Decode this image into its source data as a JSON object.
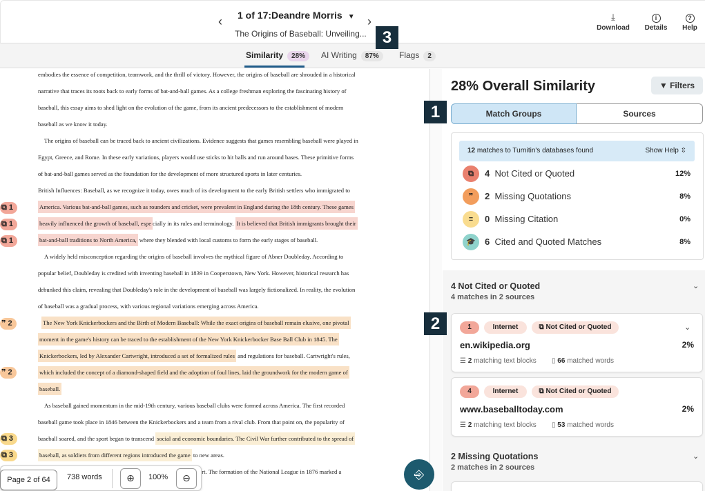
{
  "header": {
    "submission": "1 of 17:Deandre Morris",
    "paper_title": "The Origins of Baseball: Unveiling...",
    "download": "Download",
    "details": "Details",
    "help": "Help"
  },
  "tabs": [
    {
      "label": "Similarity",
      "badge": "28%"
    },
    {
      "label": "AI Writing",
      "badge": "87%"
    },
    {
      "label": "Flags",
      "badge": "2"
    }
  ],
  "callouts": {
    "one": "1",
    "two": "2",
    "three": "3"
  },
  "document": {
    "lines": [
      "embodies the essence of competition, teamwork, and the thrill of victory. However, the origins of baseball are shrouded in a historical",
      "narrative that traces its roots back to early forms of bat-and-ball games. As a college freshman exploring the fascinating history of",
      "baseball, this essay aims to shed light on the evolution of the game, from its ancient predecessors to the establishment of modern",
      "baseball as we know it today.",
      "The origins of baseball can be traced back to ancient civilizations. Evidence suggests that games resembling baseball were played in",
      "Egypt, Greece, and Rome. In these early variations, players would use sticks to hit balls and run around bases. These primitive forms",
      "of bat-and-ball games served as the foundation for the development of more structured sports in later centuries.",
      "British Influences: Baseball, as we recognize it today, owes much of its development to the early British settlers who immigrated to",
      "America. Various bat-and-ball games, such as rounders and cricket, were prevalent in England during the 18th century. These games",
      "heavily influenced the growth of baseball, espe",
      "cially in its rules and terminology. ",
      "It is believed that British immigrants brought their",
      "bat-and-ball traditions to North America,",
      " where they blended with local customs to form the early stages of baseball.",
      "A widely held misconception regarding the origins of baseball involves the mythical figure of Abner Doubleday. According to",
      "popular belief, Doubleday is credited with inventing baseball in 1839 in Cooperstown, New York. However, historical research has",
      "debunked this claim, revealing that Doubleday's role in the development of baseball was largely fictionalized. In reality, the evolution",
      "of baseball was a gradual process, with various regional variations emerging across America.",
      "The New York Knickerbockers and the Birth of Modern Baseball: While the exact origins of baseball remain elusive, one pivotal",
      "moment in the game's history can be traced to the establishment of the New York Knickerbocker Base Ball Club in 1845. The",
      "Knickerbockers, led by Alexander Cartwright, introduced a set of formalized rules",
      " and regulations for baseball. Cartwright's rules,",
      "which included the concept of a diamond-shaped field and the adoption of foul lines, laid the groundwork for the modern game of",
      "baseball.",
      "As baseball gained momentum in the mid-19th century, various baseball clubs were formed across America. The first recorded",
      "baseball game took place in 1846 between the Knickerbockers and a team from a rival club. From that point on, the popularity of",
      "baseball soared, and the sport began to transcend ",
      "social and economic boundaries. The Civil War further contributed to the spread of",
      "baseball, as soldiers from different regions introduced the game",
      " to new areas.",
      "ort. The formation of the National League in 1876 marked a"
    ],
    "markers": [
      "1",
      "1",
      "1",
      "2",
      "2",
      "3",
      "3"
    ]
  },
  "pagebar": {
    "page": "Page 2 of 64",
    "words": "738 words",
    "zoom": "100%"
  },
  "panel": {
    "overall": "28% Overall Similarity",
    "filters": "Filters",
    "seg_match": "Match Groups",
    "seg_sources": "Sources",
    "info_count": "12",
    "info_text": "matches to Turnitin's databases found",
    "show_help": "Show Help",
    "categories": [
      {
        "count": "4",
        "label": "Not Cited or Quoted",
        "pct": "12%"
      },
      {
        "count": "2",
        "label": "Missing Quotations",
        "pct": "8%"
      },
      {
        "count": "0",
        "label": "Missing Citation",
        "pct": "0%"
      },
      {
        "count": "6",
        "label": "Cited and Quoted Matches",
        "pct": "8%"
      }
    ],
    "group1": {
      "title": "4  Not Cited or Quoted",
      "sub": "4 matches in 2 sources"
    },
    "cards": [
      {
        "num": "1",
        "type": "Internet",
        "tag": "Not Cited or Quoted",
        "url": "en.wikipedia.org",
        "pct": "2%",
        "blocks": "2",
        "blocks_label": "matching text blocks",
        "words": "66",
        "words_label": "matched words"
      },
      {
        "num": "4",
        "type": "Internet",
        "tag": "Not Cited or Quoted",
        "url": "www.baseballtoday.com",
        "pct": "2%",
        "blocks": "2",
        "blocks_label": "matching text blocks",
        "words": "53",
        "words_label": "matched words"
      }
    ],
    "group2": {
      "title": "2  Missing Quotations",
      "sub": "2 matches in 2 sources"
    }
  }
}
